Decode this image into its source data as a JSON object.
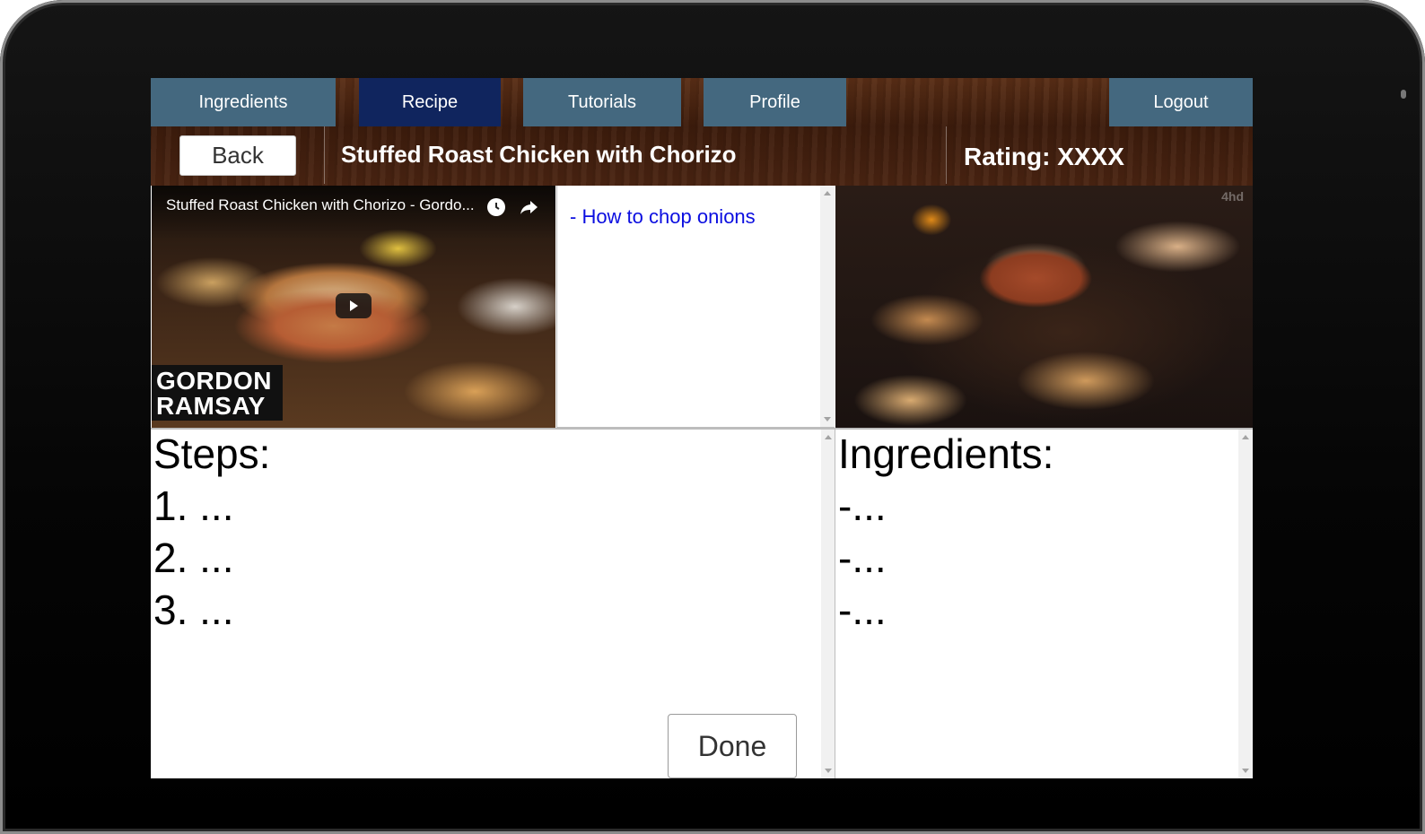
{
  "nav": {
    "tabs": [
      {
        "label": "Ingredients",
        "active": false
      },
      {
        "label": "Recipe",
        "active": true
      },
      {
        "label": "Tutorials",
        "active": false
      },
      {
        "label": "Profile",
        "active": false
      }
    ],
    "logout_label": "Logout"
  },
  "header": {
    "back_label": "Back",
    "title": "Stuffed Roast Chicken with Chorizo",
    "rating": "Rating: XXXX"
  },
  "video": {
    "title": "Stuffed Roast Chicken with Chorizo - Gordo...",
    "brand_line1": "GORDON",
    "brand_line2": "RAMSAY",
    "icons": {
      "clock": "watch-later-icon",
      "share": "share-icon",
      "play": "play-icon"
    }
  },
  "tutorials": {
    "links": [
      "- How to chop onions"
    ]
  },
  "food_image": {
    "watermark": "4hd"
  },
  "steps": {
    "heading": "Steps:",
    "items": [
      "1. ...",
      "2. ...",
      "3. ..."
    ],
    "done_label": "Done"
  },
  "ingredients": {
    "heading": "Ingredients:",
    "items": [
      "-...",
      "-...",
      "-..."
    ]
  },
  "colors": {
    "tab": "#44687f",
    "tab_active": "#10255e",
    "link": "#0b0ee0",
    "wood": "#4a2412"
  }
}
